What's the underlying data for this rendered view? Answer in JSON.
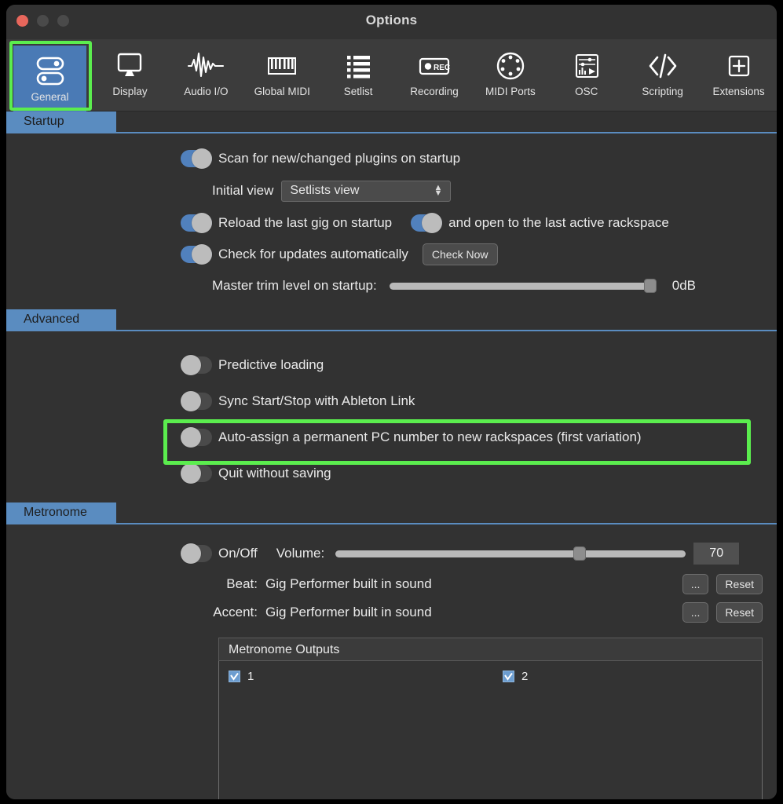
{
  "window": {
    "title": "Options",
    "traffic_lights": [
      "close",
      "minimize",
      "zoom"
    ]
  },
  "toolbar": {
    "items": [
      {
        "label": "General",
        "icon": "toggles-icon",
        "selected": true
      },
      {
        "label": "Display",
        "icon": "monitor-icon",
        "selected": false
      },
      {
        "label": "Audio I/O",
        "icon": "waveform-icon",
        "selected": false
      },
      {
        "label": "Global MIDI",
        "icon": "piano-keys-icon",
        "selected": false
      },
      {
        "label": "Setlist",
        "icon": "list-icon",
        "selected": false
      },
      {
        "label": "Recording",
        "icon": "rec-icon",
        "selected": false
      },
      {
        "label": "MIDI Ports",
        "icon": "din-connector-icon",
        "selected": false
      },
      {
        "label": "OSC",
        "icon": "mixer-play-icon",
        "selected": false
      },
      {
        "label": "Scripting",
        "icon": "code-brackets-icon",
        "selected": false
      },
      {
        "label": "Extensions",
        "icon": "plus-box-icon",
        "selected": false
      }
    ]
  },
  "sections": {
    "startup": {
      "title": "Startup",
      "scan_plugins": {
        "label": "Scan for new/changed plugins on startup",
        "state": "on"
      },
      "initial_view": {
        "label": "Initial view",
        "value": "Setlists view"
      },
      "reload_gig": {
        "label": "Reload the last gig on startup",
        "state": "on"
      },
      "open_last_rackspace": {
        "label": "and open to the last active rackspace",
        "state": "on"
      },
      "check_updates": {
        "label": "Check for updates automatically",
        "state": "on"
      },
      "check_now_button": "Check Now",
      "master_trim": {
        "label": "Master trim level on startup:",
        "value": "0dB",
        "percent": 100
      }
    },
    "advanced": {
      "title": "Advanced",
      "items": [
        {
          "label": "Predictive loading",
          "state": "off",
          "highlighted": false
        },
        {
          "label": "Sync Start/Stop with Ableton Link",
          "state": "off",
          "highlighted": false
        },
        {
          "label": "Auto-assign a permanent PC number to new rackspaces (first variation)",
          "state": "off",
          "highlighted": true
        },
        {
          "label": "Quit without saving",
          "state": "off",
          "highlighted": false
        }
      ]
    },
    "metronome": {
      "title": "Metronome",
      "onoff": {
        "label": "On/Off",
        "state": "off"
      },
      "volume": {
        "label": "Volume:",
        "value": "70",
        "percent": 70
      },
      "beat": {
        "label": "Beat:",
        "value": "Gig Performer built in sound",
        "browse": "...",
        "reset": "Reset"
      },
      "accent": {
        "label": "Accent:",
        "value": "Gig Performer built in sound",
        "browse": "...",
        "reset": "Reset"
      },
      "outputs": {
        "title": "Metronome Outputs",
        "items": [
          {
            "label": "1",
            "checked": true
          },
          {
            "label": "2",
            "checked": true
          }
        ]
      }
    }
  },
  "colors": {
    "accent_blue": "#5a8cc0",
    "toggle_on": "#5181bd",
    "highlight_green": "#5bed4e",
    "window_bg": "#323232",
    "toolbar_bg": "#3c3c3c"
  }
}
